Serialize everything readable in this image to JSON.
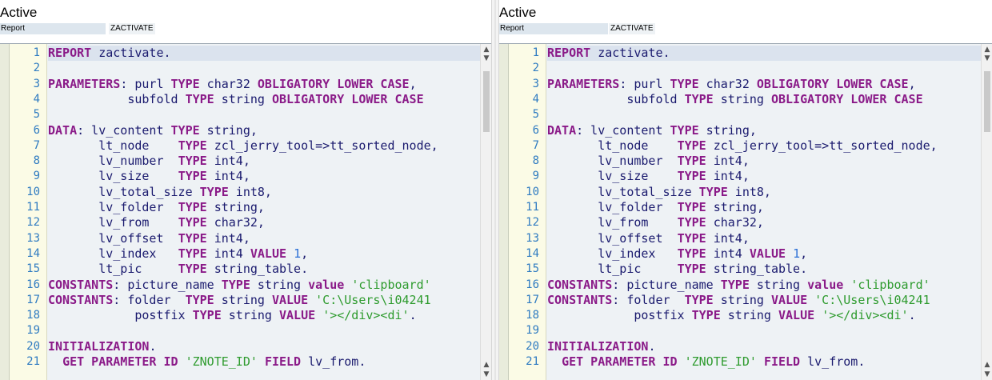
{
  "panes": [
    {
      "status": "Active",
      "object_type": "Report",
      "object_name": "ZACTIVATE"
    },
    {
      "status": "Active",
      "object_type": "Report",
      "object_name": "ZACTIVATE"
    }
  ],
  "code": {
    "line_numbers": [
      "1",
      "2",
      "3",
      "4",
      "5",
      "6",
      "7",
      "8",
      "9",
      "10",
      "11",
      "12",
      "13",
      "14",
      "15",
      "16",
      "17",
      "18",
      "19",
      "20",
      "21"
    ],
    "keywords": {
      "report": "REPORT",
      "parameters": "PARAMETERS",
      "type": "TYPE",
      "obligatory_lower_case": "OBLIGATORY LOWER CASE",
      "data": "DATA",
      "value_upper": "VALUE",
      "value_lower": "value",
      "constants": "CONSTANTS",
      "initialization": "INITIALIZATION",
      "get_parameter_id": "GET PARAMETER ID",
      "field": "FIELD"
    },
    "left": {
      "l1": " zactivate.",
      "l3a": ": purl ",
      "l3b": " char32 ",
      "l3c": ",",
      "l4a": "           subfold ",
      "l4b": " string ",
      "l6a": ": lv_content ",
      "l6b": " string,",
      "l7a": "       lt_node    ",
      "l7b": " zcl_jerry_tool=>tt_sorted_node,",
      "l8a": "       lv_number  ",
      "l8b": " int4,",
      "l9a": "       lv_size    ",
      "l9b": " int4,",
      "l10a": "       lv_total_size ",
      "l10b": " int8,",
      "l11a": "       lv_folder  ",
      "l11b": " string,",
      "l12a": "       lv_from    ",
      "l12b": " char32,",
      "l13a": "       lv_offset  ",
      "l13b": " int4,",
      "l14a": "       lv_index   ",
      "l14b": " int4 ",
      "l14num": "1",
      "l14c": ",",
      "l15a": "       lt_pic     ",
      "l15b": " string_table.",
      "l16a": ": picture_name ",
      "l16b": " string ",
      "l16str": "'clipboard'",
      "l17a": ": folder  ",
      "l17b": " string ",
      "l17str": "'C:\\Users\\i04241",
      "l18a": "            postfix ",
      "l18b": " string ",
      "l18str": "'></div><di'",
      "l18c": ".",
      "l20a": ".",
      "l21pre": "  ",
      "l21str": "'ZNOTE_ID'",
      "l21b": " lv_from."
    }
  },
  "colors": {
    "keyword": "#8a1a88",
    "identifier": "#1a1a6e",
    "string": "#2e9b2e",
    "number": "#2a6fd6",
    "line_number": "#2f7bc1"
  }
}
